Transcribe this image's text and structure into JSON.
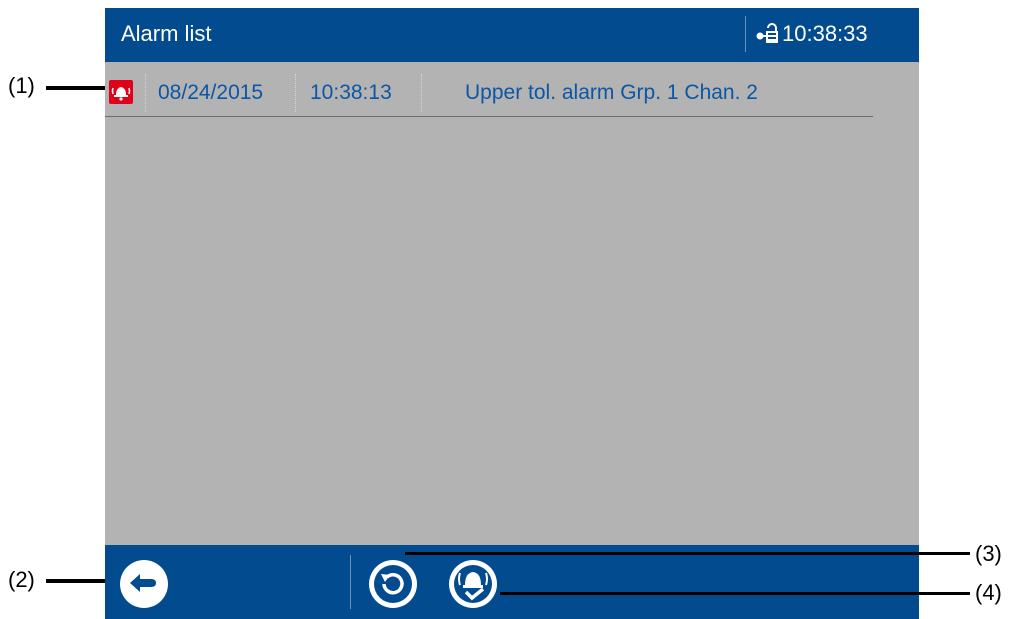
{
  "header": {
    "title": "Alarm list",
    "clock": "10:38:33"
  },
  "alarms": [
    {
      "date": "08/24/2015",
      "time": "10:38:13",
      "text": "Upper tol. alarm Grp. 1 Chan. 2",
      "icon": "alarm-bell-icon"
    }
  ],
  "toolbar": {
    "back_icon": "back-arrow-icon",
    "refresh_icon": "refresh-icon",
    "acknowledge_icon": "acknowledge-alarm-icon"
  },
  "callouts": [
    "(1)",
    "(2)",
    "(3)",
    "(4)"
  ],
  "colors": {
    "bar": "#024b8f",
    "background": "#b3b3b3",
    "alarm_text": "#0d56a6",
    "alarm_icon": "#e0001a"
  }
}
